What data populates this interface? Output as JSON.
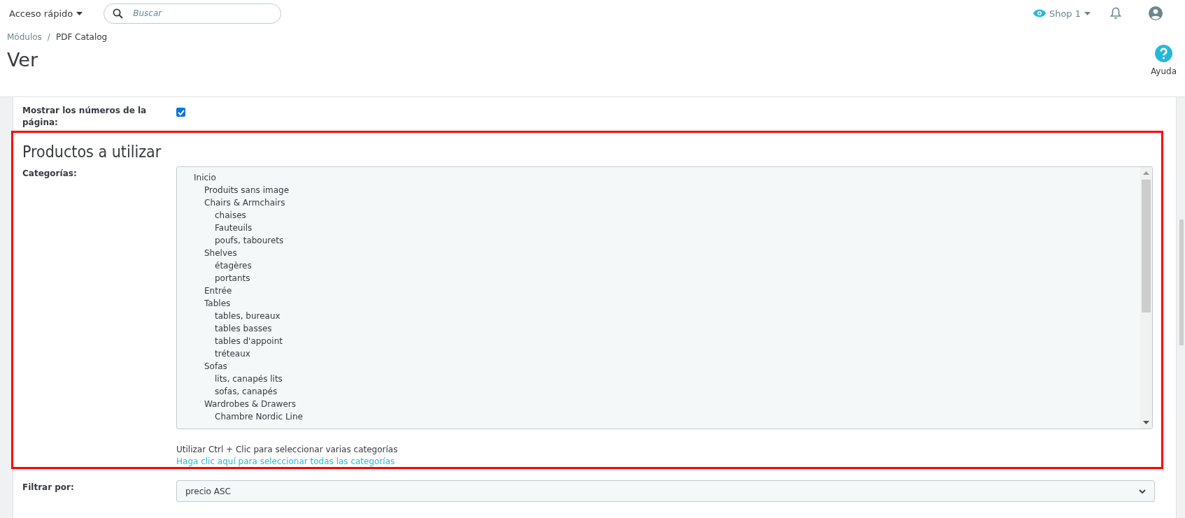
{
  "topbar": {
    "quick_access": "Acceso rápido",
    "search": {
      "placeholder": "Buscar"
    },
    "shop": "Shop 1"
  },
  "breadcrumb": [
    "Módulos",
    "/",
    "PDF Catalog"
  ],
  "page_title": "Ver",
  "help": "Ayuda",
  "page_numbers": {
    "label": "Mostrar los números de la página:",
    "checked": true
  },
  "section_title": "Productos a utilizar",
  "categories": {
    "label": "Categorías:",
    "items": [
      {
        "label": "Inicio",
        "selected": false,
        "children": [
          {
            "label": "Produits sans image",
            "selected": false
          },
          {
            "label": "Chairs & Armchairs",
            "selected": false,
            "children": [
              {
                "label": "chaises",
                "selected": false
              },
              {
                "label": "Fauteuils",
                "selected": false
              },
              {
                "label": "poufs, tabourets",
                "selected": false
              }
            ]
          },
          {
            "label": "Shelves",
            "selected": false,
            "children": [
              {
                "label": "étagères",
                "selected": false
              },
              {
                "label": "portants",
                "selected": false
              }
            ]
          },
          {
            "label": "Entrée",
            "selected": false
          },
          {
            "label": "Tables",
            "selected": false,
            "children": [
              {
                "label": "tables, bureaux",
                "selected": false
              },
              {
                "label": "tables basses",
                "selected": false
              },
              {
                "label": "tables d'appoint",
                "selected": false
              },
              {
                "label": "tréteaux",
                "selected": false
              }
            ]
          },
          {
            "label": "Sofas",
            "selected": false,
            "children": [
              {
                "label": "lits, canapés lits",
                "selected": false
              },
              {
                "label": "sofas, canapés",
                "selected": false
              }
            ]
          },
          {
            "label": "Wardrobes & Drawers",
            "selected": false,
            "children": [
              {
                "label": "Chambre Nordic Line",
                "selected": false
              }
            ]
          }
        ]
      }
    ],
    "hint": "Utilizar Ctrl + Clic para seleccionar varias categorías",
    "select_all_link": "Haga clic aquí para seleccionar todas las categorías"
  },
  "filter": {
    "label": "Filtrar por:",
    "value": "precio ASC"
  }
}
